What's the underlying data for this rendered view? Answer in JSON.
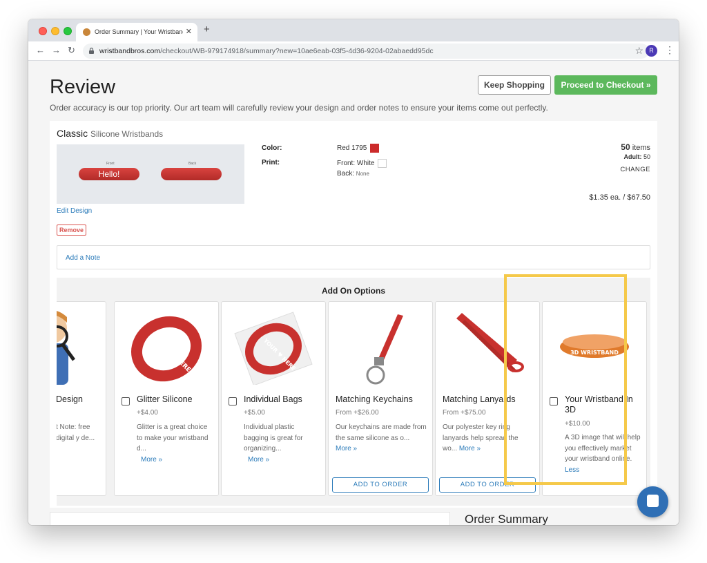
{
  "browser": {
    "tab_title": "Order Summary | Your Wristband",
    "tab_close": "✕",
    "new_tab": "+",
    "url_domain": "wristbandbros.com",
    "url_path": "/checkout/WB-979174918/summary?new=10ae6eab-03f5-4d36-9204-02abaedd95dc",
    "profile_initial": "R"
  },
  "header": {
    "title": "Review",
    "keep_shopping": "Keep Shopping",
    "proceed": "Proceed to Checkout »",
    "subtitle": "Order accuracy is our top priority. Our art team will carefully review your design and order notes to ensure your items come out perfectly."
  },
  "product": {
    "name": "Classic",
    "type": "Silicone Wristbands",
    "preview_text": "Hello!",
    "front_label": "Front",
    "back_label": "Back",
    "edit": "Edit Design",
    "remove": "Remove",
    "color_label": "Color:",
    "color_value": "Red 1795",
    "print_label": "Print:",
    "print_front": "Front: White",
    "print_back_label": "Back:",
    "print_back_value": "None",
    "qty": "50",
    "qty_unit": "items",
    "adult_label": "Adult:",
    "adult_value": "50",
    "change": "CHANGE",
    "price": "$1.35 ea. / $67.50"
  },
  "note": {
    "label": "Add a Note"
  },
  "addons": {
    "title": "Add On Options",
    "items": [
      {
        "title": "Design",
        "price": "",
        "desc": "t Note: free digital y de...",
        "more": ""
      },
      {
        "title": "Glitter Silicone",
        "price": "+$4.00",
        "desc": "Glitter is a great choice to make your wristband d...",
        "more": "More »"
      },
      {
        "title": "Individual Bags",
        "price": "+$5.00",
        "desc": "Individual plastic bagging is great for organizing...",
        "more": "More »"
      },
      {
        "title": "Matching Keychains",
        "price": "From +$26.00",
        "desc": "Our keychains are made from the same silicone as o...",
        "more": "More »",
        "button": "ADD TO ORDER"
      },
      {
        "title": "Matching Lanyards",
        "price": "From +$75.00",
        "desc": "Our polyester key ring lanyards help spread the wo...",
        "more": "More »",
        "button": "ADD TO ORDER"
      },
      {
        "title": "Your Wristband In 3D",
        "price": "+$10.00",
        "desc": "A 3D image that will help you effectively market your wristband online.",
        "more": "Less"
      }
    ],
    "wristband_text": "YOUR ♥ HERE",
    "wristband_3d_text": "3D WRISTBAND"
  },
  "footer": {
    "order_summary": "Order Summary"
  },
  "colors": {
    "accent_green": "#5cb85c",
    "link_blue": "#2a7ab9",
    "highlight": "#f5c94a",
    "band_red": "#cc2b2b"
  }
}
